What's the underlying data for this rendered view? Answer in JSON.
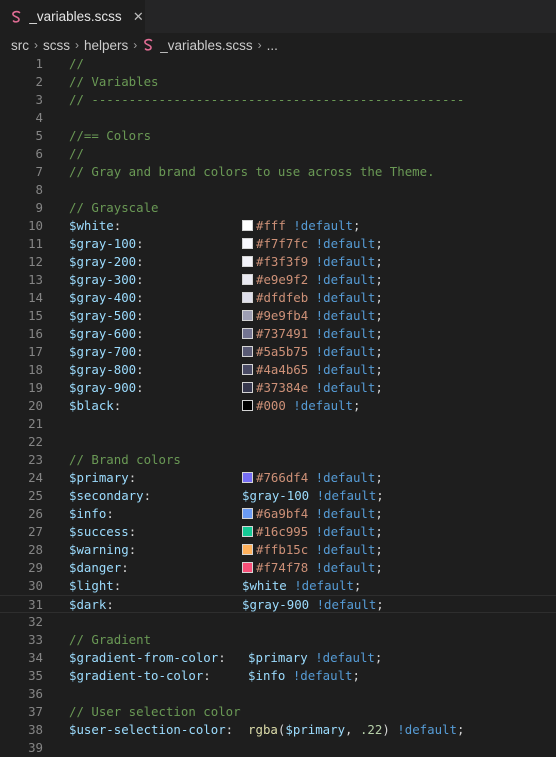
{
  "tab": {
    "filename": "_variables.scss",
    "close_symbol": "✕",
    "icon": "sass-icon"
  },
  "breadcrumb": {
    "items": [
      "src",
      "scss",
      "helpers",
      "_variables.scss",
      "..."
    ],
    "separator": "›"
  },
  "colors": {
    "comment": "#6a9955",
    "variable": "#9cdcfe",
    "string": "#ce9178",
    "keyword": "#569cd6",
    "number": "#b5cea8",
    "function": "#dcdcaa",
    "sass_icon": "#e06c94"
  },
  "editor": {
    "lines": [
      {
        "n": "1",
        "tokens": [
          [
            "comment",
            "//"
          ]
        ]
      },
      {
        "n": "2",
        "tokens": [
          [
            "comment",
            "// Variables"
          ]
        ]
      },
      {
        "n": "3",
        "tokens": [
          [
            "comment",
            "// --------------------------------------------------"
          ]
        ]
      },
      {
        "n": "4",
        "tokens": []
      },
      {
        "n": "5",
        "tokens": [
          [
            "comment",
            "//== Colors"
          ]
        ]
      },
      {
        "n": "6",
        "tokens": [
          [
            "comment",
            "//"
          ]
        ]
      },
      {
        "n": "7",
        "tokens": [
          [
            "comment",
            "// Gray and brand colors to use across the Theme."
          ]
        ]
      },
      {
        "n": "8",
        "tokens": []
      },
      {
        "n": "9",
        "tokens": [
          [
            "comment",
            "// Grayscale"
          ]
        ]
      },
      {
        "n": "10",
        "name": "$white",
        "swatch": "#ffffff",
        "value": [
          [
            "str",
            "#fff"
          ],
          [
            "kw",
            " !default"
          ],
          [
            "punc",
            ";"
          ]
        ]
      },
      {
        "n": "11",
        "name": "$gray-100",
        "swatch": "#f7f7fc",
        "value": [
          [
            "str",
            "#f7f7fc"
          ],
          [
            "kw",
            " !default"
          ],
          [
            "punc",
            ";"
          ]
        ]
      },
      {
        "n": "12",
        "name": "$gray-200",
        "swatch": "#f3f3f9",
        "value": [
          [
            "str",
            "#f3f3f9"
          ],
          [
            "kw",
            " !default"
          ],
          [
            "punc",
            ";"
          ]
        ]
      },
      {
        "n": "13",
        "name": "$gray-300",
        "swatch": "#e9e9f2",
        "value": [
          [
            "str",
            "#e9e9f2"
          ],
          [
            "kw",
            " !default"
          ],
          [
            "punc",
            ";"
          ]
        ]
      },
      {
        "n": "14",
        "name": "$gray-400",
        "swatch": "#dfdfeb",
        "value": [
          [
            "str",
            "#dfdfeb"
          ],
          [
            "kw",
            " !default"
          ],
          [
            "punc",
            ";"
          ]
        ]
      },
      {
        "n": "15",
        "name": "$gray-500",
        "swatch": "#9e9fb4",
        "value": [
          [
            "str",
            "#9e9fb4"
          ],
          [
            "kw",
            " !default"
          ],
          [
            "punc",
            ";"
          ]
        ]
      },
      {
        "n": "16",
        "name": "$gray-600",
        "swatch": "#737491",
        "value": [
          [
            "str",
            "#737491"
          ],
          [
            "kw",
            " !default"
          ],
          [
            "punc",
            ";"
          ]
        ]
      },
      {
        "n": "17",
        "name": "$gray-700",
        "swatch": "#5a5b75",
        "value": [
          [
            "str",
            "#5a5b75"
          ],
          [
            "kw",
            " !default"
          ],
          [
            "punc",
            ";"
          ]
        ]
      },
      {
        "n": "18",
        "name": "$gray-800",
        "swatch": "#4a4b65",
        "value": [
          [
            "str",
            "#4a4b65"
          ],
          [
            "kw",
            " !default"
          ],
          [
            "punc",
            ";"
          ]
        ]
      },
      {
        "n": "19",
        "name": "$gray-900",
        "swatch": "#37384e",
        "value": [
          [
            "str",
            "#37384e"
          ],
          [
            "kw",
            " !default"
          ],
          [
            "punc",
            ";"
          ]
        ]
      },
      {
        "n": "20",
        "name": "$black",
        "swatch": "#000000",
        "value": [
          [
            "str",
            "#000"
          ],
          [
            "kw",
            " !default"
          ],
          [
            "punc",
            ";"
          ]
        ]
      },
      {
        "n": "21",
        "tokens": []
      },
      {
        "n": "22",
        "tokens": []
      },
      {
        "n": "23",
        "tokens": [
          [
            "comment",
            "// Brand colors"
          ]
        ]
      },
      {
        "n": "24",
        "name": "$primary",
        "swatch": "#766df4",
        "value": [
          [
            "str",
            "#766df4"
          ],
          [
            "kw",
            " !default"
          ],
          [
            "punc",
            ";"
          ]
        ]
      },
      {
        "n": "25",
        "name": "$secondary",
        "value": [
          [
            "var",
            "$gray-100"
          ],
          [
            "kw",
            " !default"
          ],
          [
            "punc",
            ";"
          ]
        ]
      },
      {
        "n": "26",
        "name": "$info",
        "swatch": "#6a9bf4",
        "value": [
          [
            "str",
            "#6a9bf4"
          ],
          [
            "kw",
            " !default"
          ],
          [
            "punc",
            ";"
          ]
        ]
      },
      {
        "n": "27",
        "name": "$success",
        "swatch": "#16c995",
        "value": [
          [
            "str",
            "#16c995"
          ],
          [
            "kw",
            " !default"
          ],
          [
            "punc",
            ";"
          ]
        ]
      },
      {
        "n": "28",
        "name": "$warning",
        "swatch": "#ffb15c",
        "value": [
          [
            "str",
            "#ffb15c"
          ],
          [
            "kw",
            " !default"
          ],
          [
            "punc",
            ";"
          ]
        ]
      },
      {
        "n": "29",
        "name": "$danger",
        "swatch": "#f74f78",
        "value": [
          [
            "str",
            "#f74f78"
          ],
          [
            "kw",
            " !default"
          ],
          [
            "punc",
            ";"
          ]
        ]
      },
      {
        "n": "30",
        "name": "$light",
        "value": [
          [
            "var",
            "$white"
          ],
          [
            "kw",
            " !default"
          ],
          [
            "punc",
            ";"
          ]
        ]
      },
      {
        "n": "31",
        "name": "$dark",
        "current": true,
        "value": [
          [
            "var",
            "$gray-900"
          ],
          [
            "kw",
            " !default"
          ],
          [
            "punc",
            ";"
          ]
        ]
      },
      {
        "n": "32",
        "tokens": []
      },
      {
        "n": "33",
        "tokens": [
          [
            "comment",
            "// Gradient"
          ]
        ]
      },
      {
        "n": "34",
        "tokens": [
          [
            "var",
            "$gradient-from-color"
          ],
          [
            "punc",
            ":   "
          ],
          [
            "var",
            "$primary"
          ],
          [
            "kw",
            " !default"
          ],
          [
            "punc",
            ";"
          ]
        ]
      },
      {
        "n": "35",
        "tokens": [
          [
            "var",
            "$gradient-to-color"
          ],
          [
            "punc",
            ":     "
          ],
          [
            "var",
            "$info"
          ],
          [
            "kw",
            " !default"
          ],
          [
            "punc",
            ";"
          ]
        ]
      },
      {
        "n": "36",
        "tokens": []
      },
      {
        "n": "37",
        "tokens": [
          [
            "comment",
            "// User selection color"
          ]
        ]
      },
      {
        "n": "38",
        "tokens": [
          [
            "var",
            "$user-selection-color"
          ],
          [
            "punc",
            ":  "
          ],
          [
            "fn",
            "rgba"
          ],
          [
            "punc",
            "("
          ],
          [
            "var",
            "$primary"
          ],
          [
            "punc",
            ", "
          ],
          [
            "num",
            ".22"
          ],
          [
            "punc",
            ")"
          ],
          [
            "kw",
            " !default"
          ],
          [
            "punc",
            ";"
          ]
        ]
      },
      {
        "n": "39",
        "tokens": []
      }
    ]
  }
}
